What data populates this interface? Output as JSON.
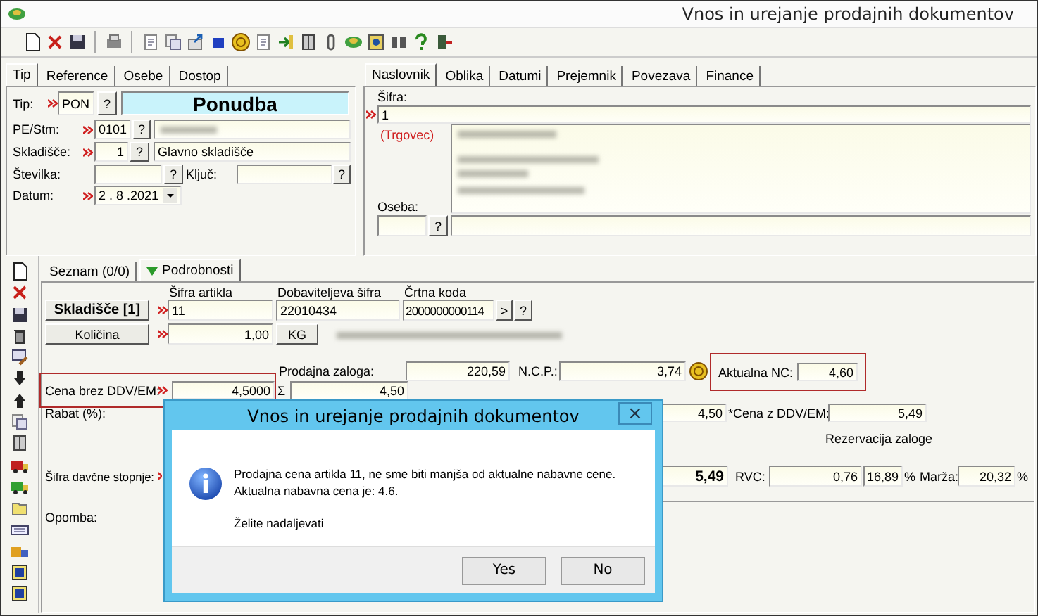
{
  "window": {
    "title": "Vnos in urejanje prodajnih dokumentov"
  },
  "header_tabs": [
    {
      "label": "Tip",
      "selected": true
    },
    {
      "label": "Reference",
      "selected": false
    },
    {
      "label": "Osebe",
      "selected": false
    },
    {
      "label": "Dostop",
      "selected": false
    }
  ],
  "header_form": {
    "tip": {
      "label": "Tip:",
      "required": true,
      "value": "PON",
      "lookup": "?",
      "name": "Ponudba"
    },
    "pe_stm": {
      "label": "PE/Stm:",
      "required": true,
      "value": "0101",
      "lookup": "?"
    },
    "skladisce": {
      "label": "Skladišče:",
      "required": true,
      "value": "1",
      "lookup": "?",
      "name": "Glavno skladišče"
    },
    "stevilka": {
      "label": "Številka:",
      "lookup": "?"
    },
    "kljuc": {
      "label": "Ključ:",
      "lookup": "?"
    },
    "datum": {
      "label": "Datum:",
      "required": true,
      "value": "2 . 8 .2021"
    }
  },
  "address_tabs": [
    {
      "label": "Naslovnik",
      "selected": true
    },
    {
      "label": "Oblika",
      "selected": false
    },
    {
      "label": "Datumi",
      "selected": false
    },
    {
      "label": "Prejemnik",
      "selected": false
    },
    {
      "label": "Povezava",
      "selected": false
    },
    {
      "label": "Finance",
      "selected": false
    }
  ],
  "address": {
    "sifra": {
      "label": "Šifra:",
      "required": true,
      "value": "1"
    },
    "role": "(Trgovec)",
    "oseba": {
      "label": "Oseba:",
      "lookup": "?"
    }
  },
  "detail_tabs": [
    {
      "label": "Seznam (0/0)",
      "selected": false
    },
    {
      "label": "Podrobnosti",
      "selected": true
    }
  ],
  "detail": {
    "columns": [
      "Šifra artikla",
      "Dobaviteljeva šifra",
      "Črtna koda"
    ],
    "article": {
      "button": "Skladišče [1]",
      "required": true,
      "sifra": "11",
      "dobaviteljeva_sifra": "22010434",
      "crtna_koda": "2000000000114",
      "next": ">",
      "lookup": "?"
    },
    "quantity": {
      "button": "Količina",
      "required": true,
      "value": "1,00",
      "unit": "KG"
    },
    "prodajna_zaloga": {
      "label": "Prodajna zaloga:",
      "value": "220,59"
    },
    "ncp": {
      "label": "N.C.P.:",
      "value": "3,74"
    },
    "aktualna_nc": {
      "label": "Aktualna NC:",
      "value": "4,60",
      "highlighted": true
    },
    "cena_brez_ddv": {
      "label": "Cena brez DDV/EM:",
      "required": true,
      "value": "4,5000",
      "highlighted": true
    },
    "sum": {
      "label": "Σ",
      "value": "4,50"
    },
    "rabat": {
      "label": "Rabat (%):",
      "value": "4,50"
    },
    "cena_z_ddv": {
      "label": "*Cena z DDV/EM:",
      "value": "5,49"
    },
    "rezervacija": "Rezervacija zaloge",
    "davcna_stopnja": {
      "label": "Šifra davčne stopnje:",
      "required": true
    },
    "total": "5,49",
    "rvc": {
      "label": "RVC:",
      "value": "0,76",
      "percent": "16,89",
      "unit": "%"
    },
    "marza": {
      "label": "Marža:",
      "value": "20,32",
      "unit": "%"
    },
    "opomba": {
      "label": "Opomba:"
    }
  },
  "dialog": {
    "title": "Vnos in urejanje prodajnih dokumentov",
    "close": "×",
    "message": [
      "Prodajna cena artikla 11, ne sme biti manjša od aktualne nabavne cene.",
      "Aktualna nabavna cena je: 4.6."
    ],
    "question": "Želite nadaljevati",
    "buttons": [
      "Yes",
      "No"
    ]
  }
}
